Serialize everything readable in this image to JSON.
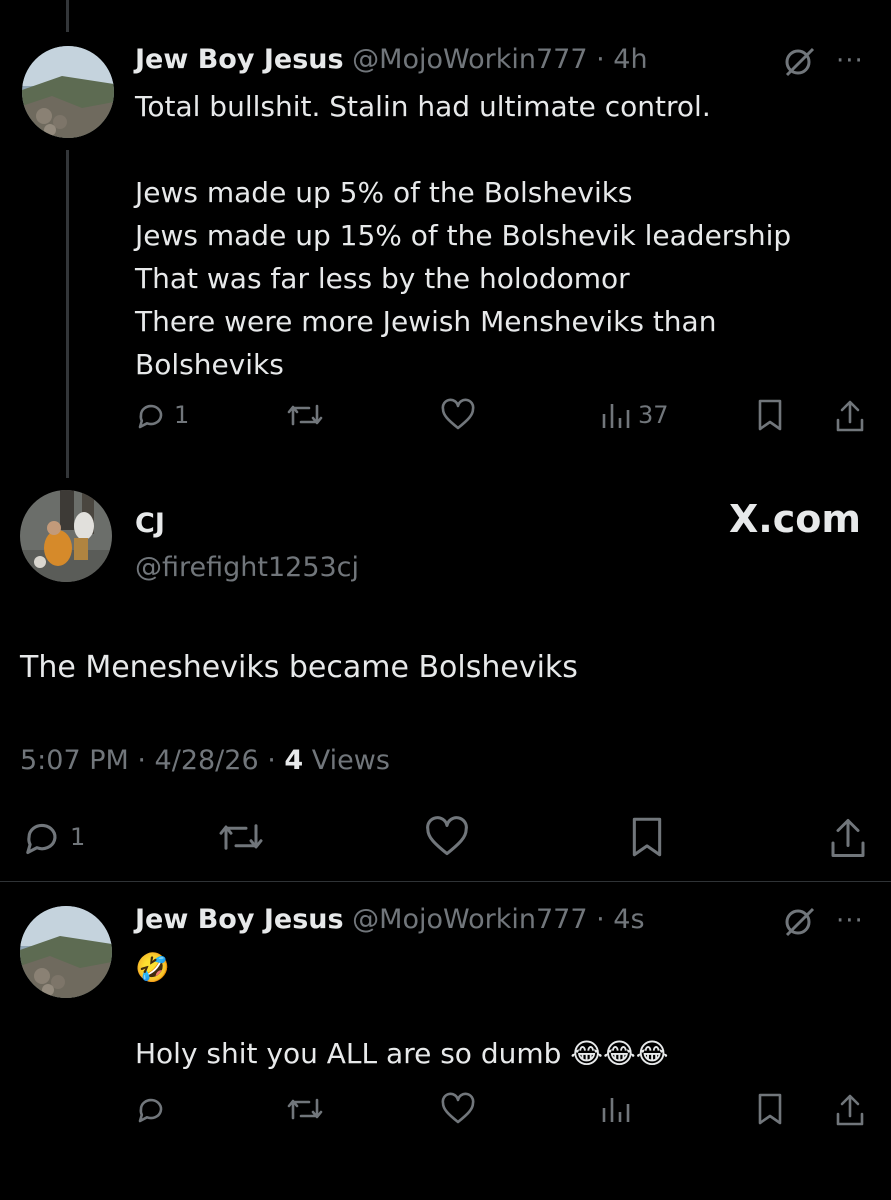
{
  "tweet1": {
    "name": "Jew Boy Jesus",
    "handle": "@MojoWorkin777",
    "time": "· 4h",
    "lines": [
      "Total bullshit. Stalin had ultimate control.",
      "",
      "Jews made up 5% of the Bolsheviks",
      "Jews made up 15% of the Bolshevik leadership",
      "That was far less by the holodomor",
      "There were more Jewish Mensheviks than",
      "Bolsheviks"
    ],
    "replies": "1",
    "views": "37"
  },
  "tweet2": {
    "name": "CJ",
    "handle": "@firefight1253cj",
    "text": "The Menesheviks became Bolsheviks",
    "timestamp": "5:07 PM · 4/28/26 ·",
    "views_count": "4",
    "views_label": "Views",
    "replies": "1",
    "brand": "X.com"
  },
  "tweet3": {
    "name": "Jew Boy Jesus",
    "handle": "@MojoWorkin777",
    "time": "· 4s",
    "emoji_line": "🤣",
    "text": "Holy shit you ALL are so dumb 😂😂😂"
  },
  "icons": {
    "grok": "grok-icon",
    "more": "···",
    "reply": "reply-icon",
    "retweet": "retweet-icon",
    "like": "heart-icon",
    "views": "views-icon",
    "bookmark": "bookmark-icon",
    "share": "share-icon"
  },
  "colors": {
    "background": "#000000",
    "text": "#e7e9ea",
    "muted": "#71767b",
    "divider": "#2f3336"
  }
}
